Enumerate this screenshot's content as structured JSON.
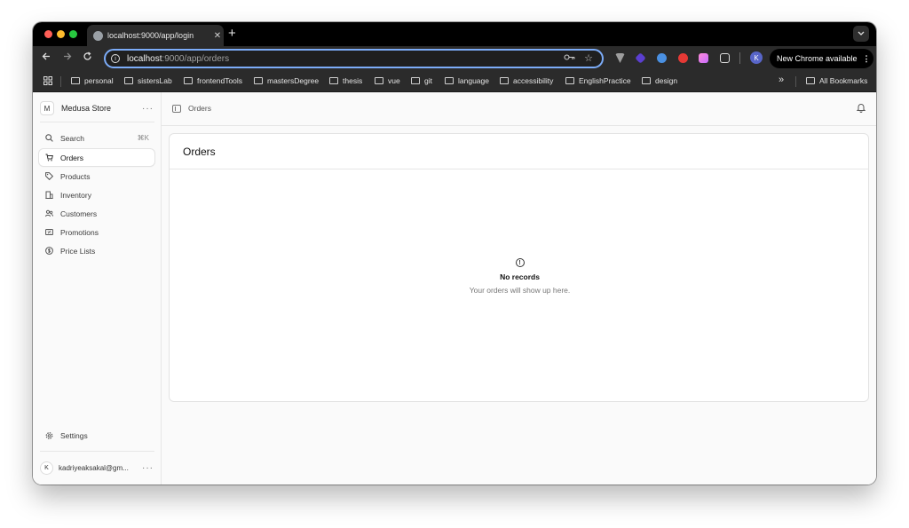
{
  "browser": {
    "tab_title": "localhost:9000/app/login",
    "close_glyph": "✕",
    "new_tab_glyph": "+",
    "url_host": "localhost",
    "url_path": ":9000/app/orders",
    "profile_initial": "K",
    "update_label": "New Chrome available",
    "bookmarks": [
      "personal",
      "sistersLab",
      "frontendTools",
      "mastersDegree",
      "thesis",
      "vue",
      "git",
      "language",
      "accessibility",
      "EnglishPractice",
      "design"
    ],
    "all_bookmarks_label": "All Bookmarks",
    "traffic_colors": {
      "close": "#ff5f57",
      "minimize": "#febc2e",
      "zoom": "#28c840"
    }
  },
  "sidebar": {
    "store_initial": "M",
    "store_name": "Medusa Store",
    "search_label": "Search",
    "search_shortcut": "⌘K",
    "items": [
      {
        "label": "Orders",
        "icon": "cart-icon",
        "active": true
      },
      {
        "label": "Products",
        "icon": "tag-icon"
      },
      {
        "label": "Inventory",
        "icon": "building-icon"
      },
      {
        "label": "Customers",
        "icon": "users-icon"
      },
      {
        "label": "Promotions",
        "icon": "receipt-percent-icon"
      },
      {
        "label": "Price Lists",
        "icon": "currency-dollar-icon"
      }
    ],
    "settings_label": "Settings",
    "user_initial": "K",
    "user_email": "kadriyeaksakal@gm..."
  },
  "topbar": {
    "breadcrumb": "Orders"
  },
  "main": {
    "title": "Orders",
    "empty_title": "No records",
    "empty_subtitle": "Your orders will show up here."
  }
}
